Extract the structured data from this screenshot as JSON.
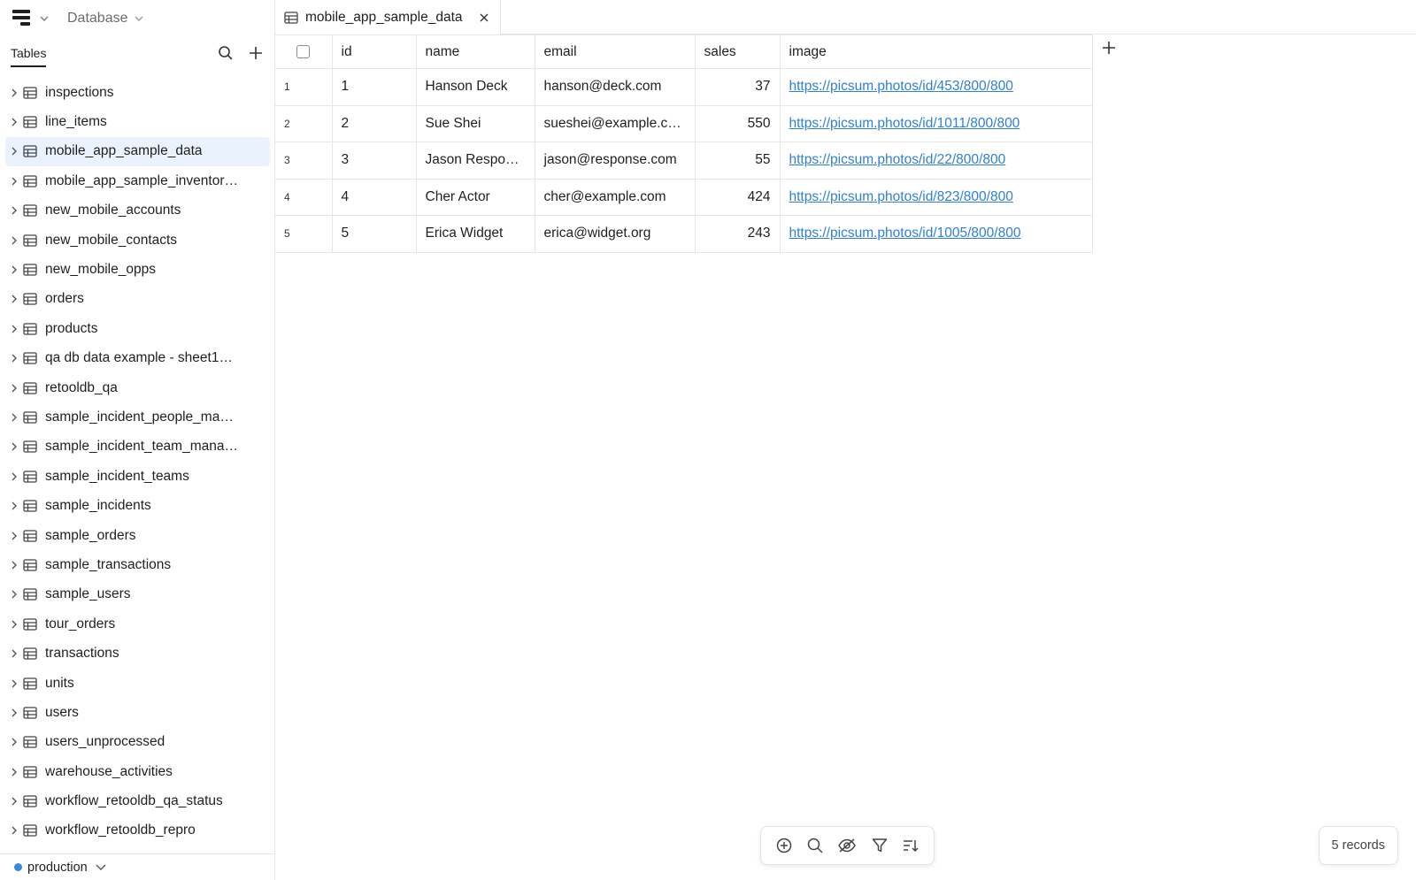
{
  "topbar": {
    "app_label": "Database"
  },
  "sidebar": {
    "tables_label": "Tables",
    "items": [
      "inspections",
      "line_items",
      "mobile_app_sample_data",
      "mobile_app_sample_inventor…",
      "new_mobile_accounts",
      "new_mobile_contacts",
      "new_mobile_opps",
      "orders",
      "products",
      "qa db data example - sheet1…",
      "retooldb_qa",
      "sample_incident_people_ma…",
      "sample_incident_team_mana…",
      "sample_incident_teams",
      "sample_incidents",
      "sample_orders",
      "sample_transactions",
      "sample_users",
      "tour_orders",
      "transactions",
      "units",
      "users",
      "users_unprocessed",
      "warehouse_activities",
      "workflow_retooldb_qa_status",
      "workflow_retooldb_repro"
    ],
    "active_item": "mobile_app_sample_data",
    "environment": "production"
  },
  "tab": {
    "title": "mobile_app_sample_data"
  },
  "grid": {
    "columns": [
      "id",
      "name",
      "email",
      "sales",
      "image"
    ],
    "rows": [
      {
        "n": "1",
        "id": "1",
        "name": "Hanson Deck",
        "email": "hanson@deck.com",
        "sales": "37",
        "image": "https://picsum.photos/id/453/800/800"
      },
      {
        "n": "2",
        "id": "2",
        "name": "Sue Shei",
        "email": "sueshei@example.c…",
        "sales": "550",
        "image": "https://picsum.photos/id/1011/800/800"
      },
      {
        "n": "3",
        "id": "3",
        "name": "Jason Respo…",
        "email": "jason@response.com",
        "sales": "55",
        "image": "https://picsum.photos/id/22/800/800"
      },
      {
        "n": "4",
        "id": "4",
        "name": "Cher Actor",
        "email": "cher@example.com",
        "sales": "424",
        "image": "https://picsum.photos/id/823/800/800"
      },
      {
        "n": "5",
        "id": "5",
        "name": "Erica Widget",
        "email": "erica@widget.org",
        "sales": "243",
        "image": "https://picsum.photos/id/1005/800/800"
      }
    ]
  },
  "footer": {
    "records": "5 records"
  },
  "colors": {
    "accent": "#3b87e0",
    "link": "#2f7fd6",
    "active_bg": "#eaf2fd",
    "border": "#e6e6e6"
  }
}
